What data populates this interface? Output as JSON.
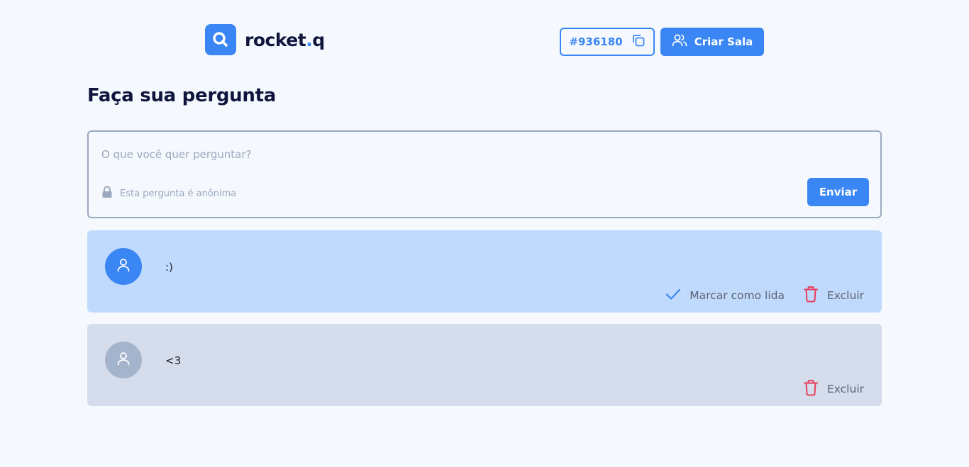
{
  "header": {
    "logo_text": "rocket",
    "logo_dot": ".",
    "logo_suffix": "q",
    "room_code": "#936180",
    "create_room_label": "Criar Sala"
  },
  "main": {
    "title": "Faça sua pergunta",
    "question_placeholder": "O que você quer perguntar?",
    "anonymous_note": "Esta pergunta é anônima",
    "send_label": "Enviar"
  },
  "questions": [
    {
      "text": ":)",
      "mark_read_label": "Marcar como lida",
      "delete_label": "Excluir"
    },
    {
      "text": "<3",
      "delete_label": "Excluir"
    }
  ],
  "colors": {
    "accent": "#3A86F5",
    "background": "#F5F8FD",
    "unread_card": "#C0DAFD",
    "read_card": "#D5DCEC",
    "delete": "#E73F5D",
    "title": "#0F153D"
  },
  "icons": [
    "search-icon",
    "copy-icon",
    "users-icon",
    "lock-icon",
    "user-icon",
    "check-icon",
    "trash-icon"
  ]
}
